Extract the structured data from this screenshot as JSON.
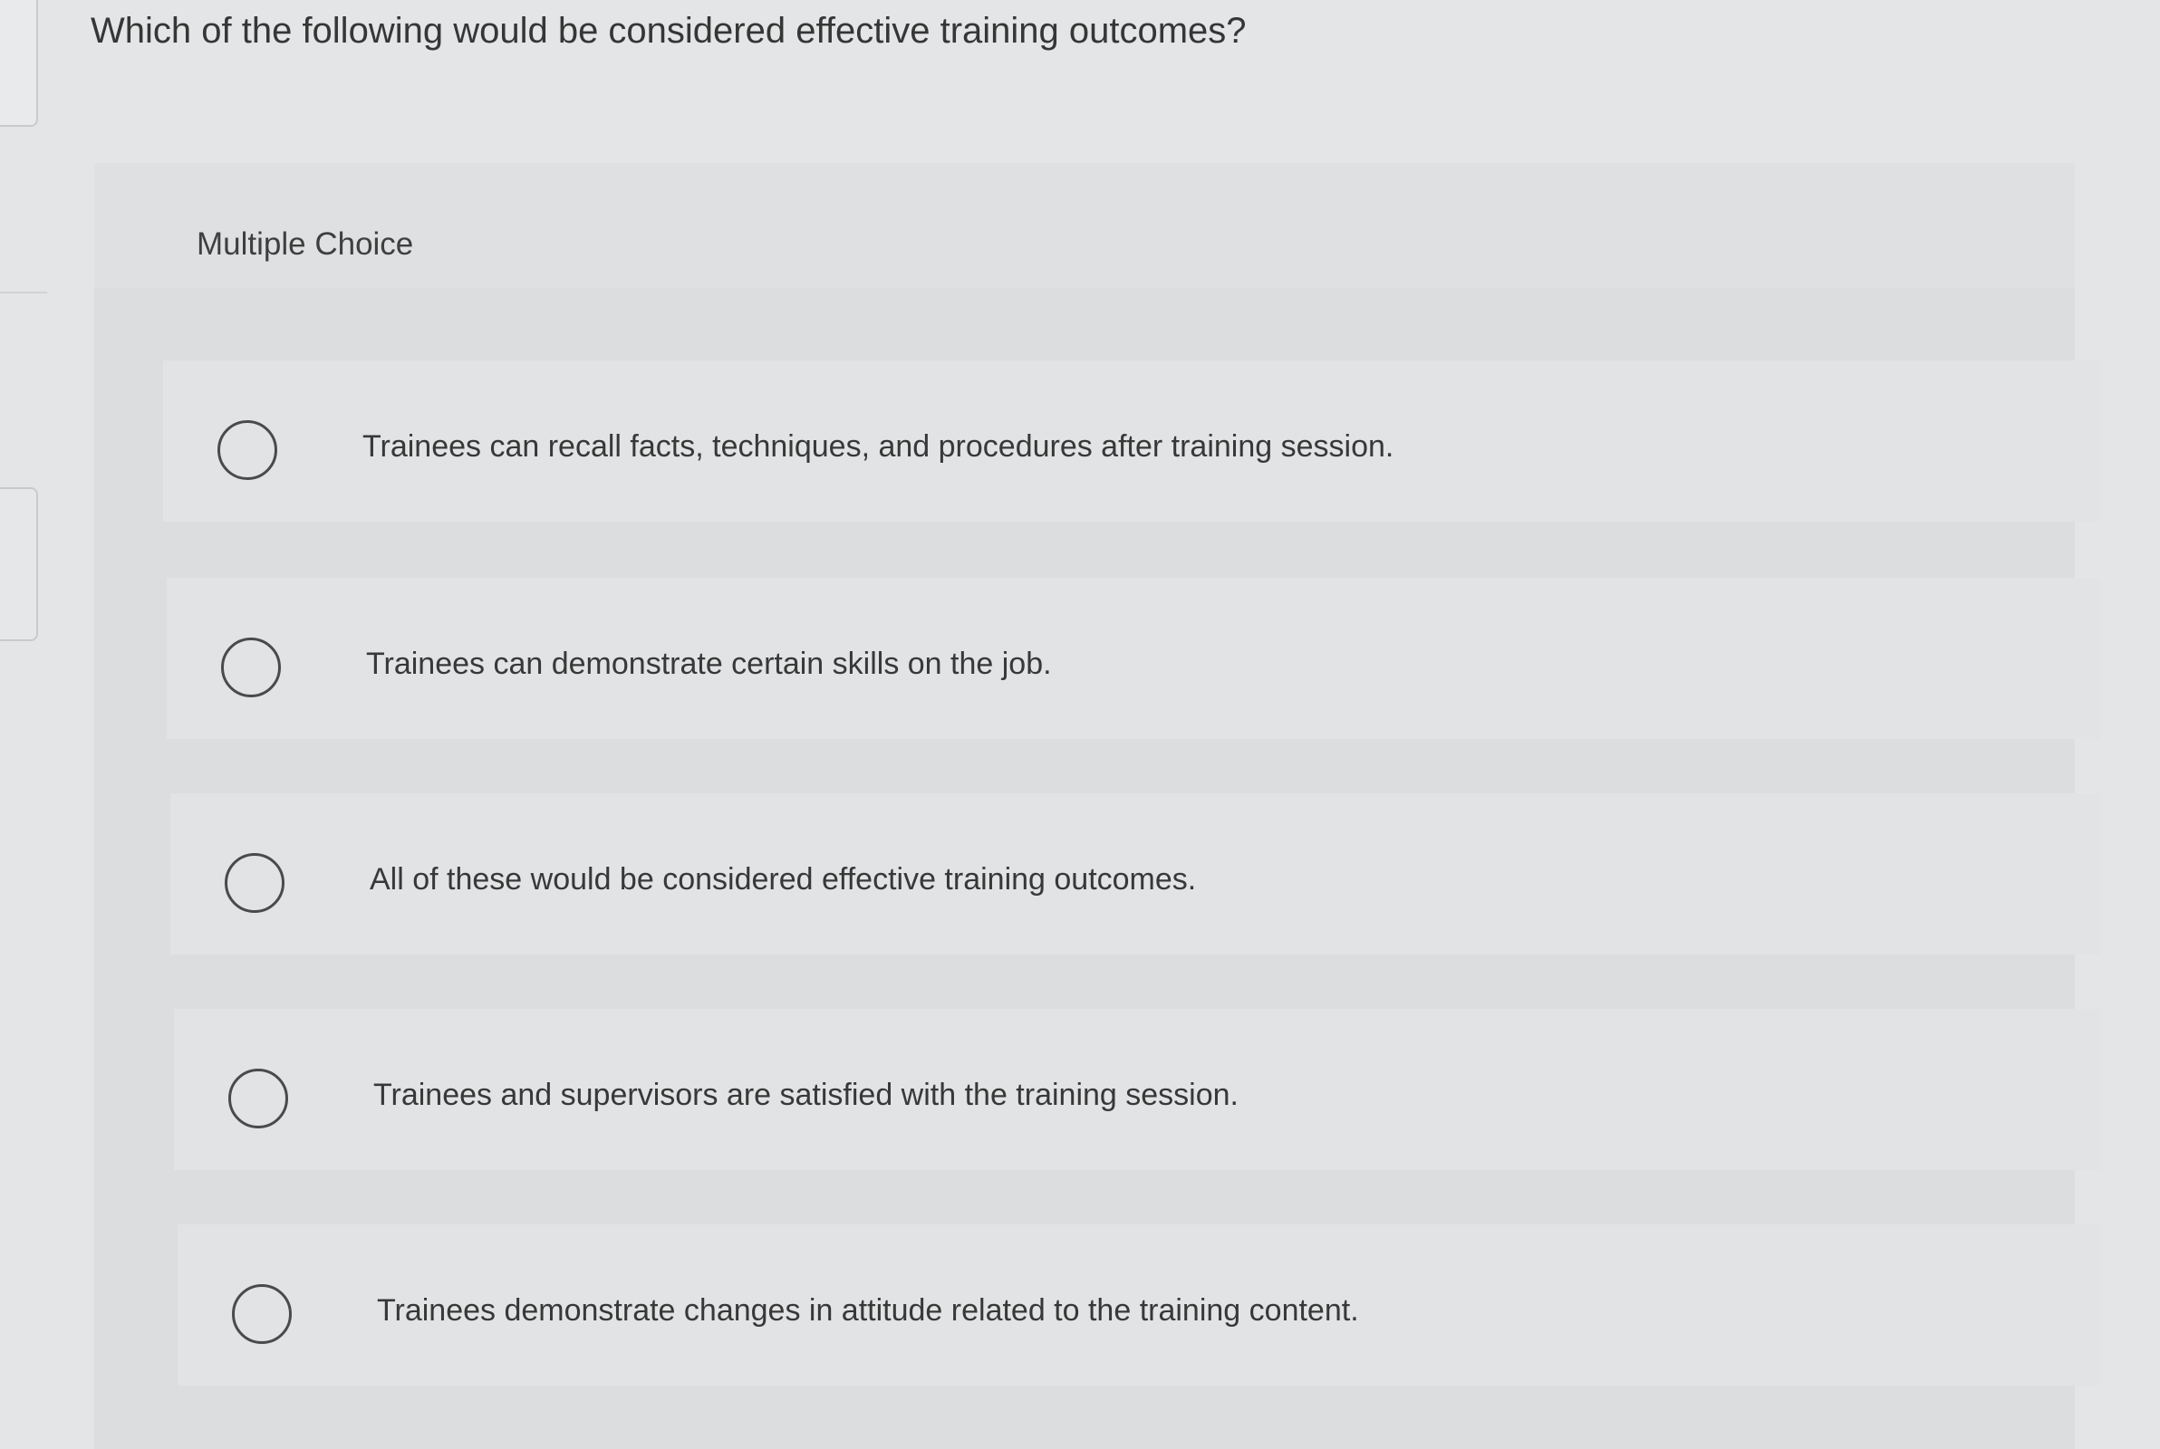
{
  "question": {
    "text": "Which of the following would be considered effective training outcomes?"
  },
  "panel": {
    "type_label": "Multiple Choice"
  },
  "choices": [
    {
      "text": "Trainees can recall facts, techniques, and procedures after training session."
    },
    {
      "text": "Trainees can demonstrate certain skills on the job."
    },
    {
      "text": "All of these would be considered effective training outcomes."
    },
    {
      "text": "Trainees and supervisors are satisfied with the training session."
    },
    {
      "text": "Trainees demonstrate changes in attitude related to the training content."
    }
  ]
}
